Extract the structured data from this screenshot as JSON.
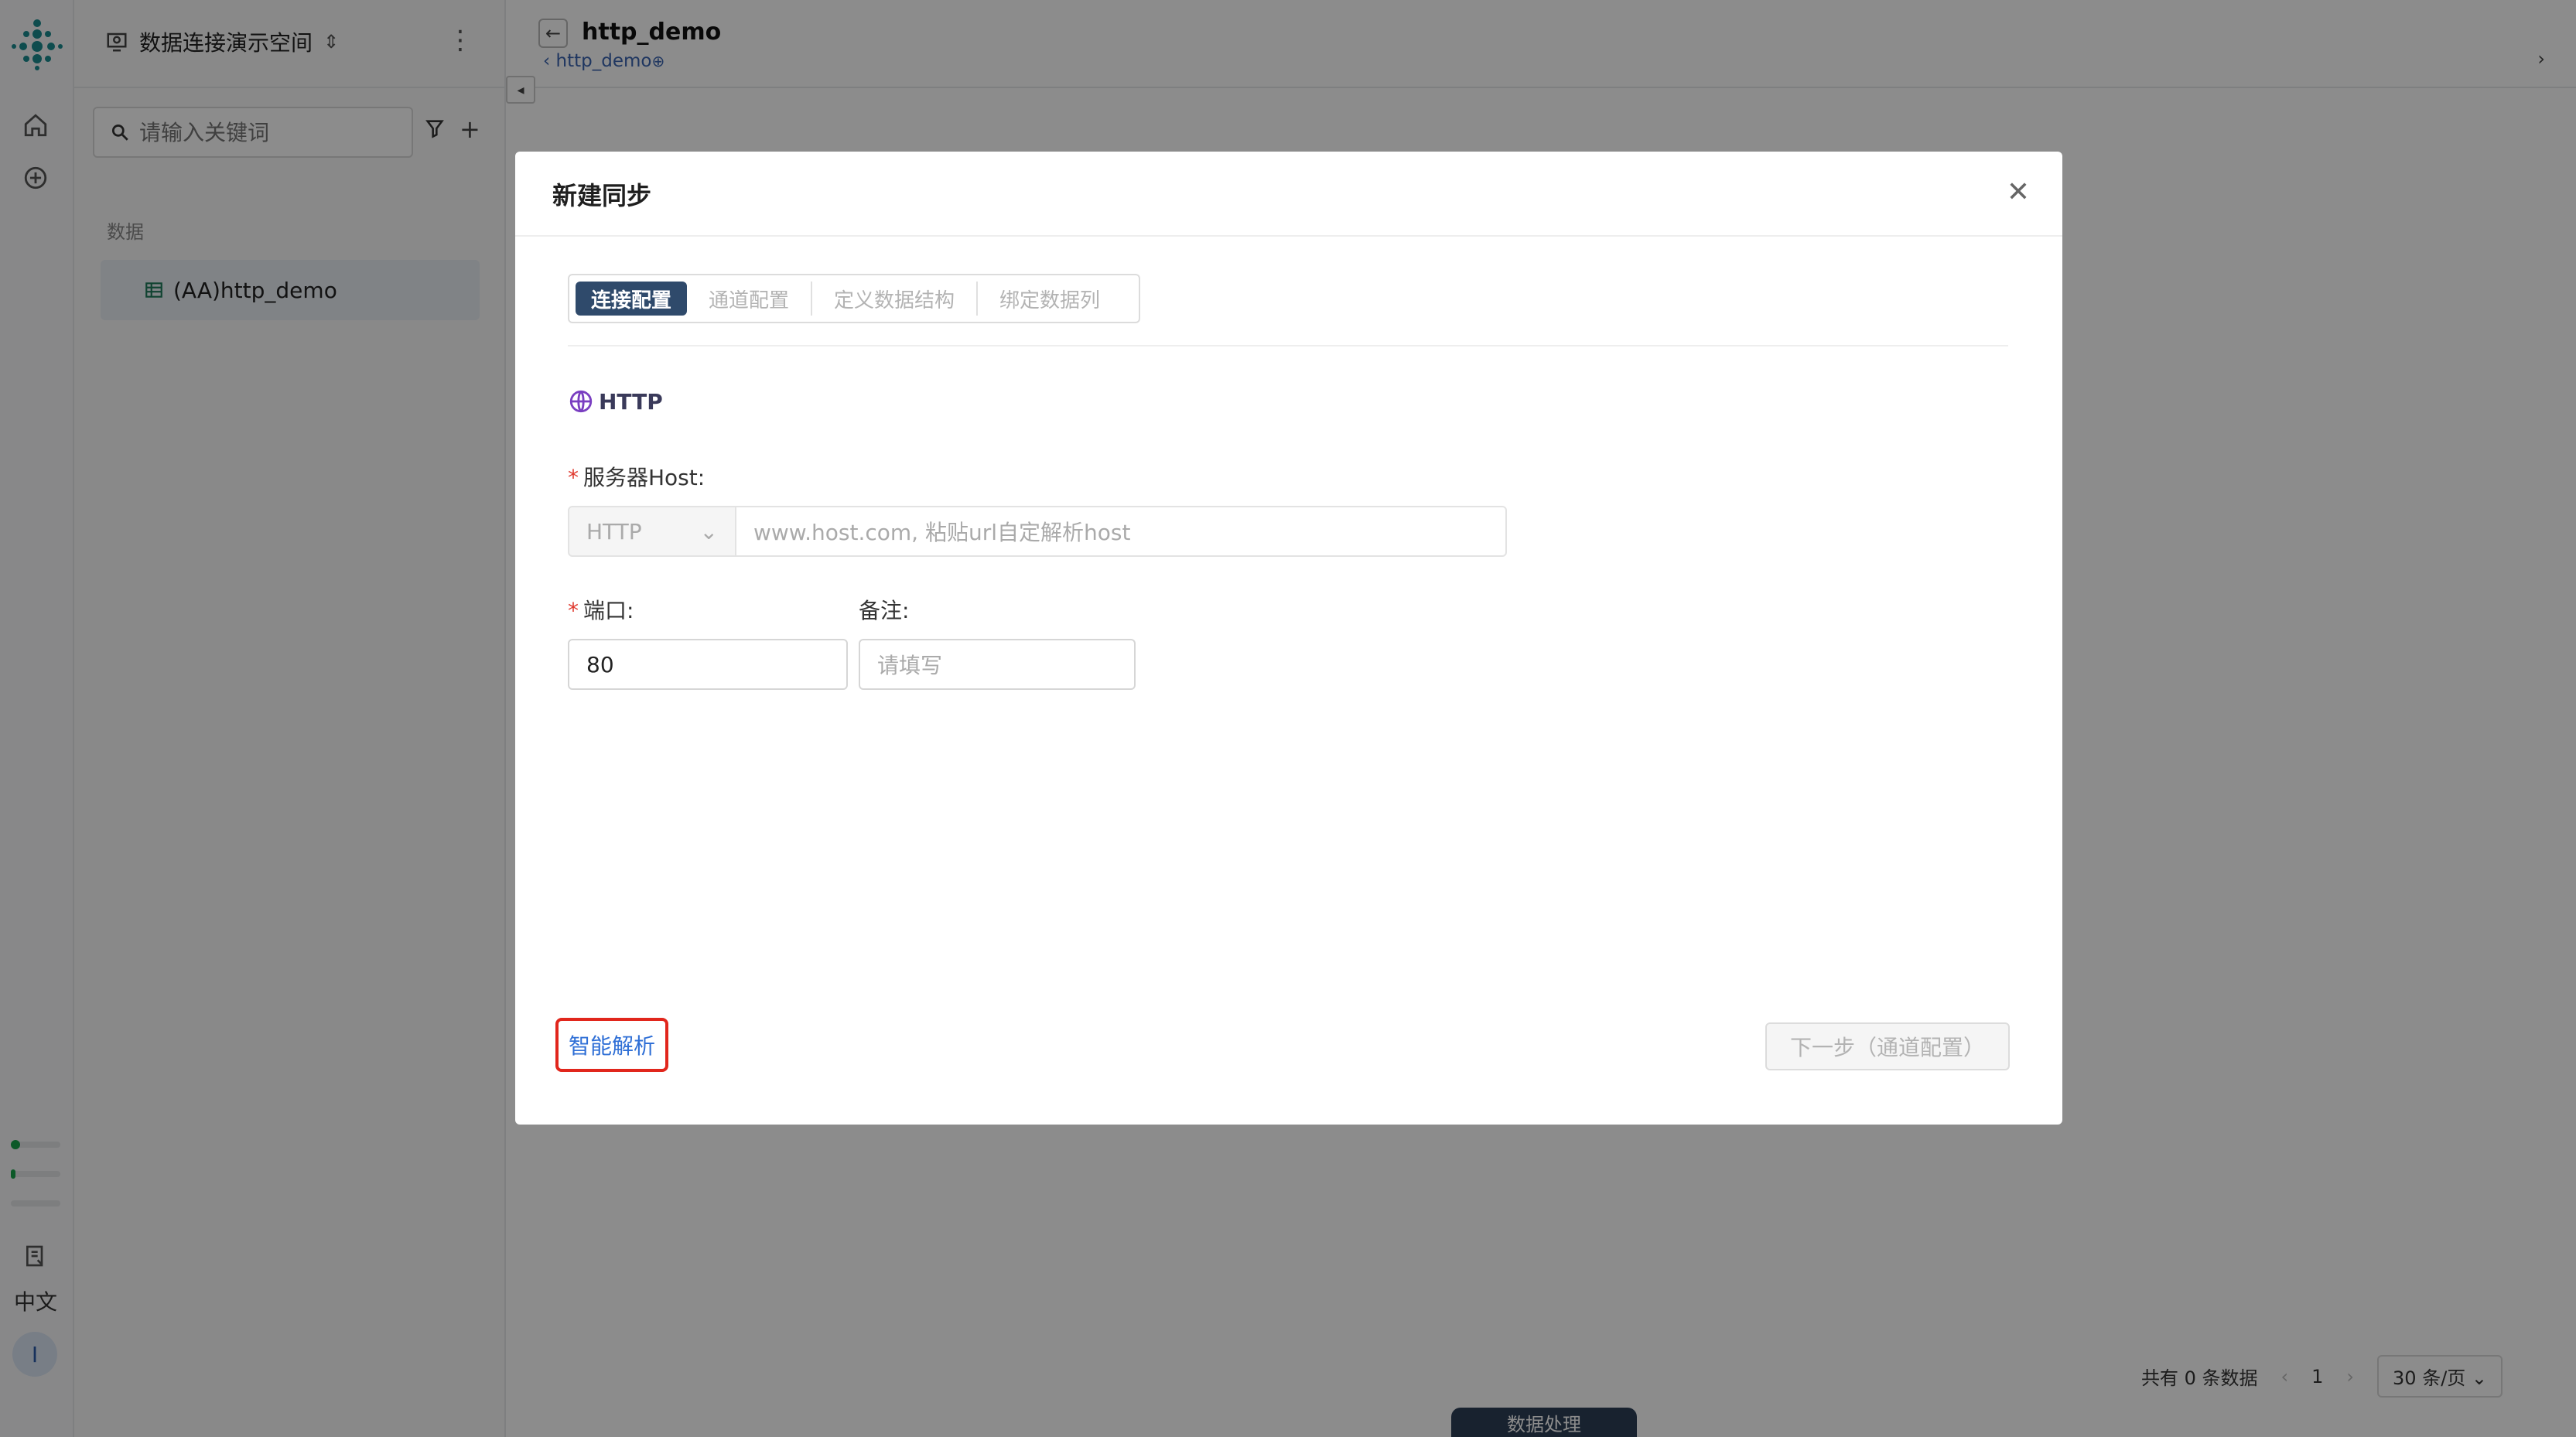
{
  "rail": {
    "language": "中文",
    "avatar_initial": "I"
  },
  "sidebar": {
    "workspace_name": "数据连接演示空间",
    "search_placeholder": "请输入关键词",
    "section_label": "数据",
    "items": [
      {
        "label": "(AA)http_demo",
        "selected": true
      }
    ]
  },
  "header": {
    "title": "http_demo",
    "breadcrumb": "http_demo"
  },
  "pagination": {
    "total_text": "共有 0 条数据",
    "current_page": "1",
    "page_size": "30 条/页"
  },
  "bottom_tab": "数据处理",
  "modal": {
    "title": "新建同步",
    "steps": [
      {
        "label": "连接配置",
        "active": true
      },
      {
        "label": "通道配置",
        "active": false
      },
      {
        "label": "定义数据结构",
        "active": false
      },
      {
        "label": "绑定数据列",
        "active": false
      }
    ],
    "protocol": "HTTP",
    "host_label": "服务器Host:",
    "host_scheme": "HTTP",
    "host_placeholder": "www.host.com, 粘贴url自定解析host",
    "port_label": "端口:",
    "port_value": "80",
    "note_label": "备注:",
    "note_placeholder": "请填写",
    "smart_parse_label": "智能解析",
    "next_label": "下一步（通道配置）"
  },
  "colors": {
    "accent_dark": "#2f4a6b",
    "link_blue": "#2f6fd6",
    "required_red": "#e03a2f",
    "highlight_red": "#e1261c"
  }
}
